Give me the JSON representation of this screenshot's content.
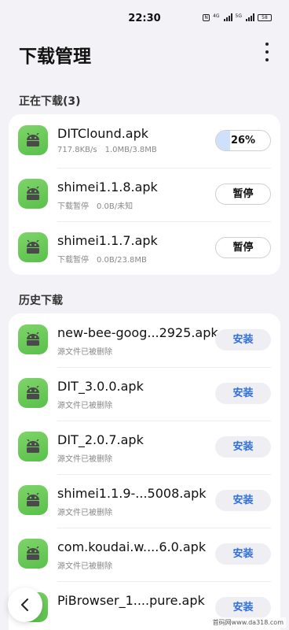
{
  "status_bar": {
    "time": "22:30",
    "signal1_label": "4G",
    "signal2_label": "5G",
    "battery": "58",
    "icons": [
      "nfc-icon",
      "signal-icon",
      "signal-icon",
      "battery-icon"
    ]
  },
  "header": {
    "title": "下载管理",
    "more_icon": "more-vertical-icon"
  },
  "downloading": {
    "title": "正在下载(3)",
    "items": [
      {
        "name": "DITClound.apk",
        "speed": "717.8KB/s",
        "size": "1.0MB/3.8MB",
        "action": "26%",
        "progress": 0.26
      },
      {
        "name": "shimei1.1.8.apk",
        "speed": "下载暂停",
        "size": "0.0B/未知",
        "action": "暂停"
      },
      {
        "name": "shimei1.1.7.apk",
        "speed": "下载暂停",
        "size": "0.0B/23.8MB",
        "action": "暂停"
      }
    ]
  },
  "history": {
    "title": "历史下载",
    "items": [
      {
        "name": "new-bee-goog...2925.apk",
        "status": "源文件已被删除",
        "action": "安装"
      },
      {
        "name": "DIT_3.0.0.apk",
        "status": "源文件已被删除",
        "action": "安装"
      },
      {
        "name": "DIT_2.0.7.apk",
        "status": "源文件已被删除",
        "action": "安装"
      },
      {
        "name": "shimei1.1.9-...5008.apk",
        "status": "源文件已被删除",
        "action": "安装"
      },
      {
        "name": "com.koudai.w....6.0.apk",
        "status": "源文件已被删除",
        "action": "安装"
      },
      {
        "name": "PiBrowser_1....pure.apk",
        "status": "",
        "action": "安装"
      }
    ]
  },
  "back_icon": "chevron-left-icon",
  "watermark": "首码网www.da318.com",
  "colors": {
    "accent": "#2f6fe0",
    "app_icon": "#6ccb5a",
    "background": "#f2f2f7"
  }
}
